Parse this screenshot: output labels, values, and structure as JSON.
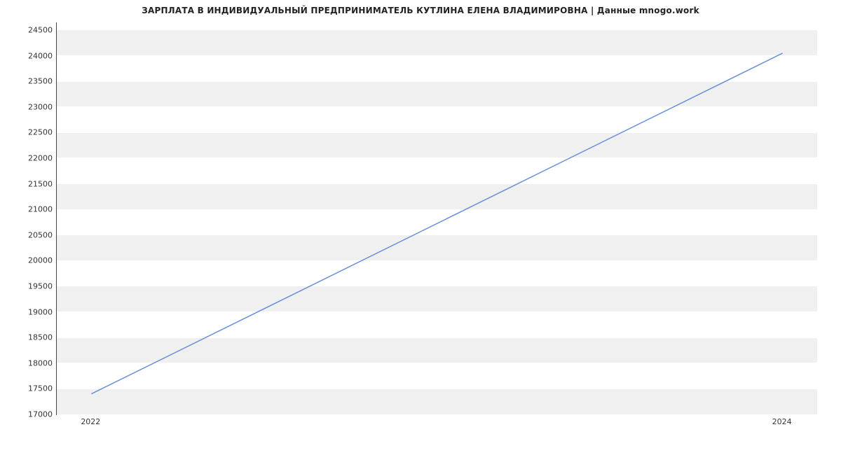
{
  "chart_data": {
    "type": "line",
    "title": "ЗАРПЛАТА В ИНДИВИДУАЛЬНЫЙ ПРЕДПРИНИМАТЕЛЬ КУТЛИНА ЕЛЕНА ВЛАДИМИРОВНА | Данные mnogo.work",
    "x": [
      2022,
      2024
    ],
    "values": [
      17400,
      24050
    ],
    "xlabel": "",
    "ylabel": "",
    "xticks": [
      2022,
      2024
    ],
    "yticks": [
      17000,
      17500,
      18000,
      18500,
      19000,
      19500,
      20000,
      20500,
      21000,
      21500,
      22000,
      22500,
      23000,
      23500,
      24000,
      24500
    ],
    "xlim": [
      2021.9,
      2024.1
    ],
    "ylim": [
      17000,
      24650
    ],
    "line_color": "#6a8fd8"
  }
}
